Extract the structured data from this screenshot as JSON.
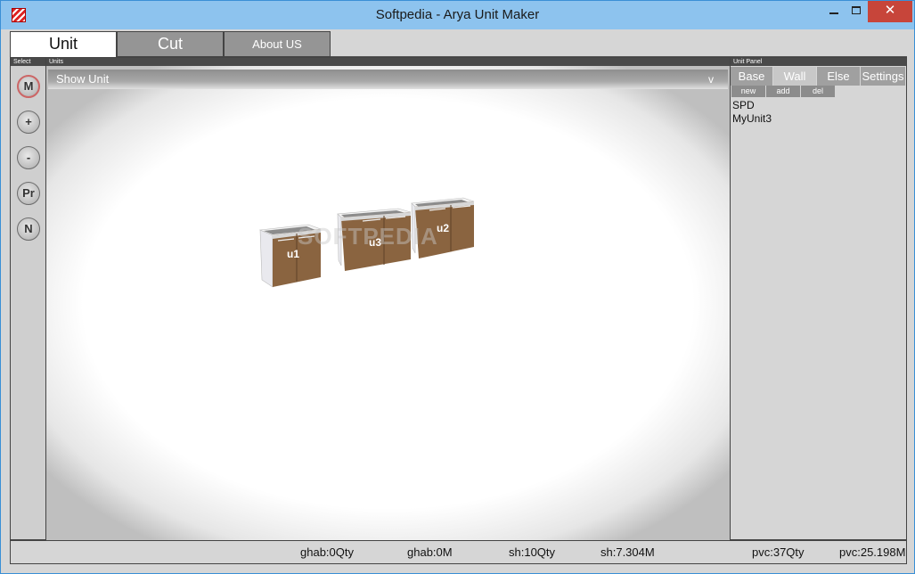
{
  "window": {
    "title": "Softpedia - Arya Unit Maker",
    "controls": {
      "minimize": "minimize-icon",
      "maximize": "maximize-icon",
      "close": "✕"
    }
  },
  "tabs": [
    {
      "label": "Unit",
      "selected": true
    },
    {
      "label": "Cut",
      "selected": false
    },
    {
      "label": "About US",
      "selected": false
    }
  ],
  "select_panel": {
    "header": "Select",
    "buttons": [
      "M",
      "+",
      "-",
      "Pr",
      "N"
    ]
  },
  "units_panel": {
    "header": "Units",
    "show_unit_label": "Show Unit",
    "show_unit_caret": "v",
    "cabinets": [
      "u1",
      "u3",
      "u2"
    ],
    "watermark": "SOFTPEDIA"
  },
  "unit_panel": {
    "header": "Unit Panel",
    "tabs": [
      {
        "label": "Base",
        "selected": false
      },
      {
        "label": "Wall",
        "selected": true
      },
      {
        "label": "Else",
        "selected": false
      },
      {
        "label": "Settings",
        "selected": false
      }
    ],
    "actions": [
      "new",
      "add",
      "del"
    ],
    "items": [
      "SPD",
      "MyUnit3"
    ]
  },
  "status": {
    "ghab_qty": "ghab:0Qty",
    "ghab_m": "ghab:0M",
    "sh_qty": "sh:10Qty",
    "sh_m": "sh:7.304M",
    "pvc_qty": "pvc:37Qty",
    "pvc_m": "pvc:25.198M"
  },
  "colors": {
    "titlebar": "#8dc3ee",
    "close_button": "#c7453a",
    "wood": "#8a6440",
    "panel_header": "#4a4a4a"
  }
}
